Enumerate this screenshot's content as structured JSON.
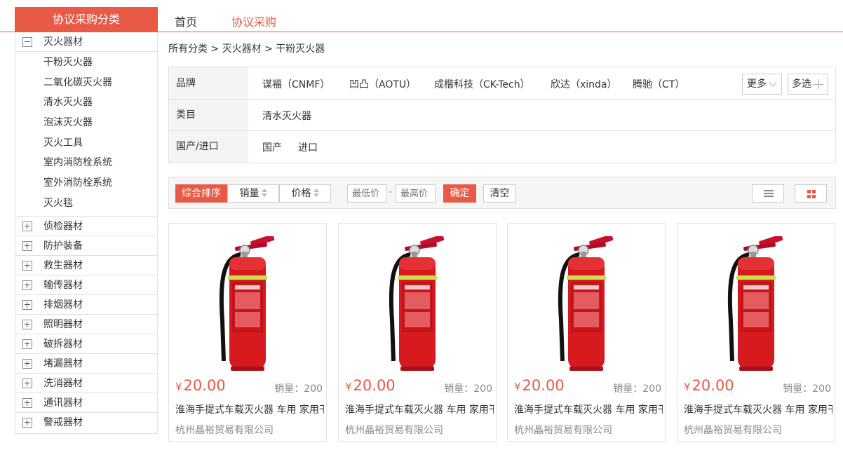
{
  "header": {
    "category_title": "协议采购分类",
    "nav": {
      "home": "首页",
      "active": "协议采购"
    }
  },
  "sidebar": {
    "expanded_group": "灭火器材",
    "sub_items": [
      "干粉灭火器",
      "二氧化碳灭火器",
      "清水灭火器",
      "泡沫灭火器",
      "灭火工具",
      "室内消防栓系统",
      "室外消防栓系统",
      "灭火毯"
    ],
    "groups": [
      "侦检器材",
      "防护装备",
      "救生器材",
      "输传器材",
      "排烟器材",
      "照明器材",
      "破拆器材",
      "堵漏器材",
      "洗消器材",
      "通讯器材",
      "警戒器材"
    ]
  },
  "breadcrumb": "所有分类 > 灭火器材 > 干粉灭火器",
  "filters": {
    "brand_label": "品牌",
    "brands": [
      "谋福（CNMF）",
      "凹凸（AOTU）",
      "成楷科技（CK-Tech）",
      "欣达（xinda）",
      "腾驰（CT）"
    ],
    "more": "更多",
    "multi": "多选",
    "category_label": "类目",
    "category_value": "清水灭火器",
    "origin_label": "国产/进口",
    "origins": [
      "国产",
      "进口"
    ]
  },
  "sortbar": {
    "default": "综合排序",
    "sales": "销量",
    "price": "价格",
    "min_placeholder": "最低价",
    "max_placeholder": "最高价",
    "confirm": "确定",
    "clear": "清空"
  },
  "products": [
    {
      "currency": "¥",
      "price": "20.00",
      "sales": "销量：200",
      "title": "淮海手提式车载灭火器 车用 家用干粉灭火器",
      "shop": "杭州晶裕贸易有限公司"
    },
    {
      "currency": "¥",
      "price": "20.00",
      "sales": "销量：200",
      "title": "淮海手提式车载灭火器 车用 家用干粉灭火器",
      "shop": "杭州晶裕贸易有限公司"
    },
    {
      "currency": "¥",
      "price": "20.00",
      "sales": "销量：200",
      "title": "淮海手提式车载灭火器 车用 家用干粉灭火器",
      "shop": "杭州晶裕贸易有限公司"
    },
    {
      "currency": "¥",
      "price": "20.00",
      "sales": "销量：200",
      "title": "淮海手提式车载灭火器 车用 家用干粉灭火器",
      "shop": "杭州晶裕贸易有限公司"
    }
  ],
  "colors": {
    "accent": "#e85a46",
    "border": "#e1e1e1"
  }
}
